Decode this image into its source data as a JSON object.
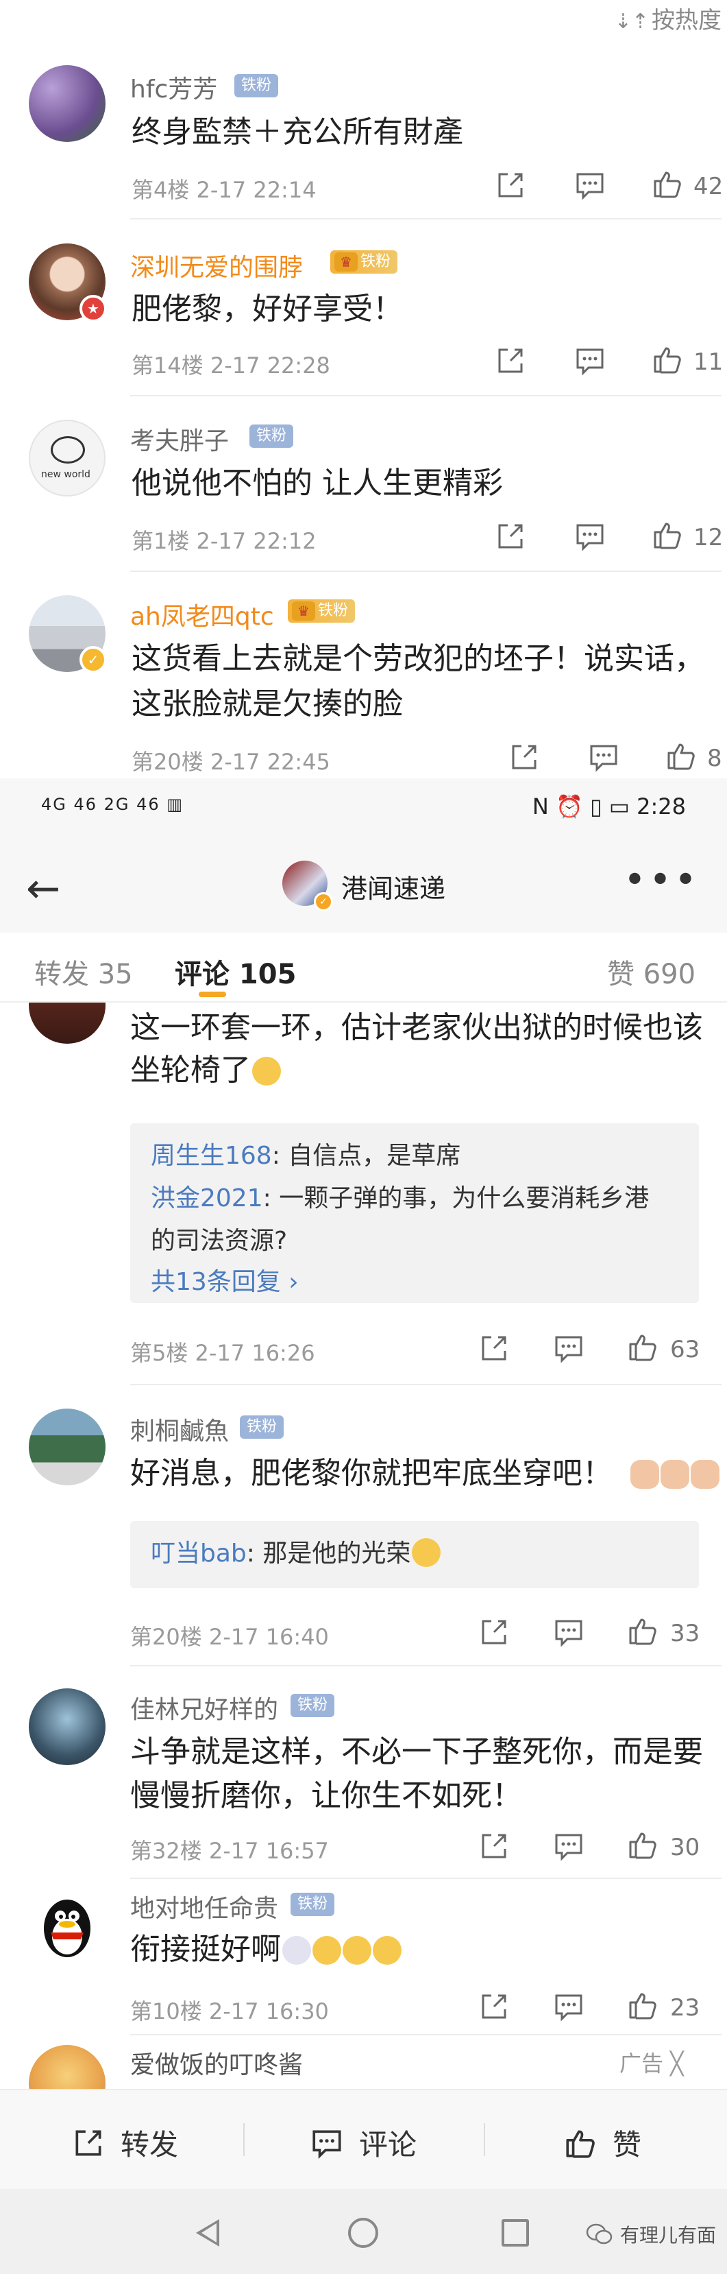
{
  "sort_link": {
    "arrow": "⇣⇡",
    "label": "按热度"
  },
  "comments_top": [
    {
      "name": "hfc芳芳",
      "badge": "铁粉",
      "text": [
        "终身監禁＋充公所有財產"
      ],
      "meta": "第4楼  2-17 22:14",
      "likes": "42"
    },
    {
      "name": "深圳无爱的围脖",
      "badge": "铁粉",
      "text": [
        "肥佬黎，好好享受！"
      ],
      "meta": "第14楼  2-17 22:28",
      "likes": "11"
    },
    {
      "name": "考夫胖子",
      "badge": "铁粉",
      "text": [
        "他说他不怕的 让人生更精彩"
      ],
      "meta": "第1楼  2-17 22:12",
      "likes": "12"
    },
    {
      "name": "ah凤老四qtc",
      "badge": "铁粉",
      "text": [
        "这货看上去就是个劳改犯的坯子！说实话，",
        "这张脸就是欠揍的脸"
      ],
      "meta": "第20楼  2-17 22:45",
      "likes": "8"
    }
  ],
  "avatar_captions": {
    "c3": "new world"
  },
  "statusbar": {
    "left": "4G 46  2G 46  ▥",
    "right": "N  ⏰  ▯  ▭  2:28"
  },
  "navbar": {
    "back": "←",
    "title": "港闻速递",
    "more": "•••"
  },
  "tabs": {
    "repost": "转发 35",
    "comment": "评论 105",
    "like": "赞 690"
  },
  "comments_bottom": [
    {
      "name": "",
      "text": [
        "这一环套一环，估计老家伙出狱的时候也该",
        "坐轮椅了"
      ],
      "replies": [
        {
          "name": "周生生168",
          "text": ": 自信点，是草席"
        },
        {
          "name": "洪金2021",
          "text": ": 一颗子弹的事，为什么要消耗乡港"
        },
        {
          "name": "",
          "text": "的司法资源?"
        }
      ],
      "more_replies": "共13条回复 ›",
      "meta": "第5楼  2-17 16:26",
      "likes": "63"
    },
    {
      "name": "刺桐鹹魚",
      "badge": "铁粉",
      "text": [
        "好消息，肥佬黎你就把牢底坐穿吧！"
      ],
      "replies": [
        {
          "name": "叮当bab",
          "text": ": 那是他的光荣"
        }
      ],
      "meta": "第20楼  2-17 16:40",
      "likes": "33"
    },
    {
      "name": "佳林兄好样的",
      "badge": "铁粉",
      "text": [
        "斗争就是这样，不必一下子整死你，而是要",
        "慢慢折磨你，让你生不如死！"
      ],
      "meta": "第32楼  2-17 16:57",
      "likes": "30"
    },
    {
      "name": "地对地任命贵",
      "badge": "铁粉",
      "text": [
        "衔接挺好啊"
      ],
      "meta": "第10楼  2-17 16:30",
      "likes": "23"
    },
    {
      "name": "爱做饭的叮咚酱",
      "ad": "广告 ╳"
    }
  ],
  "bottombar": {
    "repost": "转发",
    "comment": "评论",
    "like": "赞"
  },
  "watermark": "有理儿有面"
}
